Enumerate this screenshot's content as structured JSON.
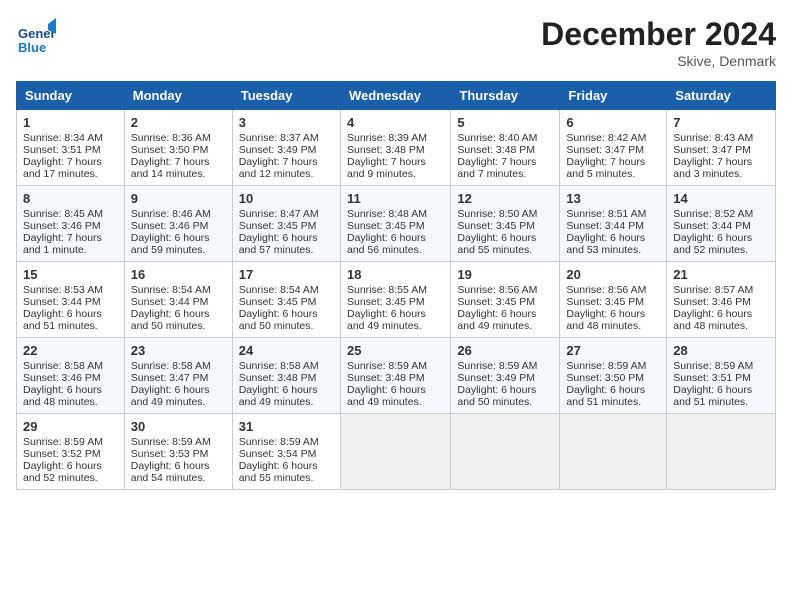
{
  "header": {
    "month_year": "December 2024",
    "location": "Skive, Denmark",
    "logo_text_general": "General",
    "logo_text_blue": "Blue"
  },
  "days_of_week": [
    "Sunday",
    "Monday",
    "Tuesday",
    "Wednesday",
    "Thursday",
    "Friday",
    "Saturday"
  ],
  "weeks": [
    [
      {
        "day": "1",
        "sunrise": "Sunrise: 8:34 AM",
        "sunset": "Sunset: 3:51 PM",
        "daylight": "Daylight: 7 hours and 17 minutes."
      },
      {
        "day": "2",
        "sunrise": "Sunrise: 8:36 AM",
        "sunset": "Sunset: 3:50 PM",
        "daylight": "Daylight: 7 hours and 14 minutes."
      },
      {
        "day": "3",
        "sunrise": "Sunrise: 8:37 AM",
        "sunset": "Sunset: 3:49 PM",
        "daylight": "Daylight: 7 hours and 12 minutes."
      },
      {
        "day": "4",
        "sunrise": "Sunrise: 8:39 AM",
        "sunset": "Sunset: 3:48 PM",
        "daylight": "Daylight: 7 hours and 9 minutes."
      },
      {
        "day": "5",
        "sunrise": "Sunrise: 8:40 AM",
        "sunset": "Sunset: 3:48 PM",
        "daylight": "Daylight: 7 hours and 7 minutes."
      },
      {
        "day": "6",
        "sunrise": "Sunrise: 8:42 AM",
        "sunset": "Sunset: 3:47 PM",
        "daylight": "Daylight: 7 hours and 5 minutes."
      },
      {
        "day": "7",
        "sunrise": "Sunrise: 8:43 AM",
        "sunset": "Sunset: 3:47 PM",
        "daylight": "Daylight: 7 hours and 3 minutes."
      }
    ],
    [
      {
        "day": "8",
        "sunrise": "Sunrise: 8:45 AM",
        "sunset": "Sunset: 3:46 PM",
        "daylight": "Daylight: 7 hours and 1 minute."
      },
      {
        "day": "9",
        "sunrise": "Sunrise: 8:46 AM",
        "sunset": "Sunset: 3:46 PM",
        "daylight": "Daylight: 6 hours and 59 minutes."
      },
      {
        "day": "10",
        "sunrise": "Sunrise: 8:47 AM",
        "sunset": "Sunset: 3:45 PM",
        "daylight": "Daylight: 6 hours and 57 minutes."
      },
      {
        "day": "11",
        "sunrise": "Sunrise: 8:48 AM",
        "sunset": "Sunset: 3:45 PM",
        "daylight": "Daylight: 6 hours and 56 minutes."
      },
      {
        "day": "12",
        "sunrise": "Sunrise: 8:50 AM",
        "sunset": "Sunset: 3:45 PM",
        "daylight": "Daylight: 6 hours and 55 minutes."
      },
      {
        "day": "13",
        "sunrise": "Sunrise: 8:51 AM",
        "sunset": "Sunset: 3:44 PM",
        "daylight": "Daylight: 6 hours and 53 minutes."
      },
      {
        "day": "14",
        "sunrise": "Sunrise: 8:52 AM",
        "sunset": "Sunset: 3:44 PM",
        "daylight": "Daylight: 6 hours and 52 minutes."
      }
    ],
    [
      {
        "day": "15",
        "sunrise": "Sunrise: 8:53 AM",
        "sunset": "Sunset: 3:44 PM",
        "daylight": "Daylight: 6 hours and 51 minutes."
      },
      {
        "day": "16",
        "sunrise": "Sunrise: 8:54 AM",
        "sunset": "Sunset: 3:44 PM",
        "daylight": "Daylight: 6 hours and 50 minutes."
      },
      {
        "day": "17",
        "sunrise": "Sunrise: 8:54 AM",
        "sunset": "Sunset: 3:45 PM",
        "daylight": "Daylight: 6 hours and 50 minutes."
      },
      {
        "day": "18",
        "sunrise": "Sunrise: 8:55 AM",
        "sunset": "Sunset: 3:45 PM",
        "daylight": "Daylight: 6 hours and 49 minutes."
      },
      {
        "day": "19",
        "sunrise": "Sunrise: 8:56 AM",
        "sunset": "Sunset: 3:45 PM",
        "daylight": "Daylight: 6 hours and 49 minutes."
      },
      {
        "day": "20",
        "sunrise": "Sunrise: 8:56 AM",
        "sunset": "Sunset: 3:45 PM",
        "daylight": "Daylight: 6 hours and 48 minutes."
      },
      {
        "day": "21",
        "sunrise": "Sunrise: 8:57 AM",
        "sunset": "Sunset: 3:46 PM",
        "daylight": "Daylight: 6 hours and 48 minutes."
      }
    ],
    [
      {
        "day": "22",
        "sunrise": "Sunrise: 8:58 AM",
        "sunset": "Sunset: 3:46 PM",
        "daylight": "Daylight: 6 hours and 48 minutes."
      },
      {
        "day": "23",
        "sunrise": "Sunrise: 8:58 AM",
        "sunset": "Sunset: 3:47 PM",
        "daylight": "Daylight: 6 hours and 49 minutes."
      },
      {
        "day": "24",
        "sunrise": "Sunrise: 8:58 AM",
        "sunset": "Sunset: 3:48 PM",
        "daylight": "Daylight: 6 hours and 49 minutes."
      },
      {
        "day": "25",
        "sunrise": "Sunrise: 8:59 AM",
        "sunset": "Sunset: 3:48 PM",
        "daylight": "Daylight: 6 hours and 49 minutes."
      },
      {
        "day": "26",
        "sunrise": "Sunrise: 8:59 AM",
        "sunset": "Sunset: 3:49 PM",
        "daylight": "Daylight: 6 hours and 50 minutes."
      },
      {
        "day": "27",
        "sunrise": "Sunrise: 8:59 AM",
        "sunset": "Sunset: 3:50 PM",
        "daylight": "Daylight: 6 hours and 51 minutes."
      },
      {
        "day": "28",
        "sunrise": "Sunrise: 8:59 AM",
        "sunset": "Sunset: 3:51 PM",
        "daylight": "Daylight: 6 hours and 51 minutes."
      }
    ],
    [
      {
        "day": "29",
        "sunrise": "Sunrise: 8:59 AM",
        "sunset": "Sunset: 3:52 PM",
        "daylight": "Daylight: 6 hours and 52 minutes."
      },
      {
        "day": "30",
        "sunrise": "Sunrise: 8:59 AM",
        "sunset": "Sunset: 3:53 PM",
        "daylight": "Daylight: 6 hours and 54 minutes."
      },
      {
        "day": "31",
        "sunrise": "Sunrise: 8:59 AM",
        "sunset": "Sunset: 3:54 PM",
        "daylight": "Daylight: 6 hours and 55 minutes."
      },
      null,
      null,
      null,
      null
    ]
  ]
}
